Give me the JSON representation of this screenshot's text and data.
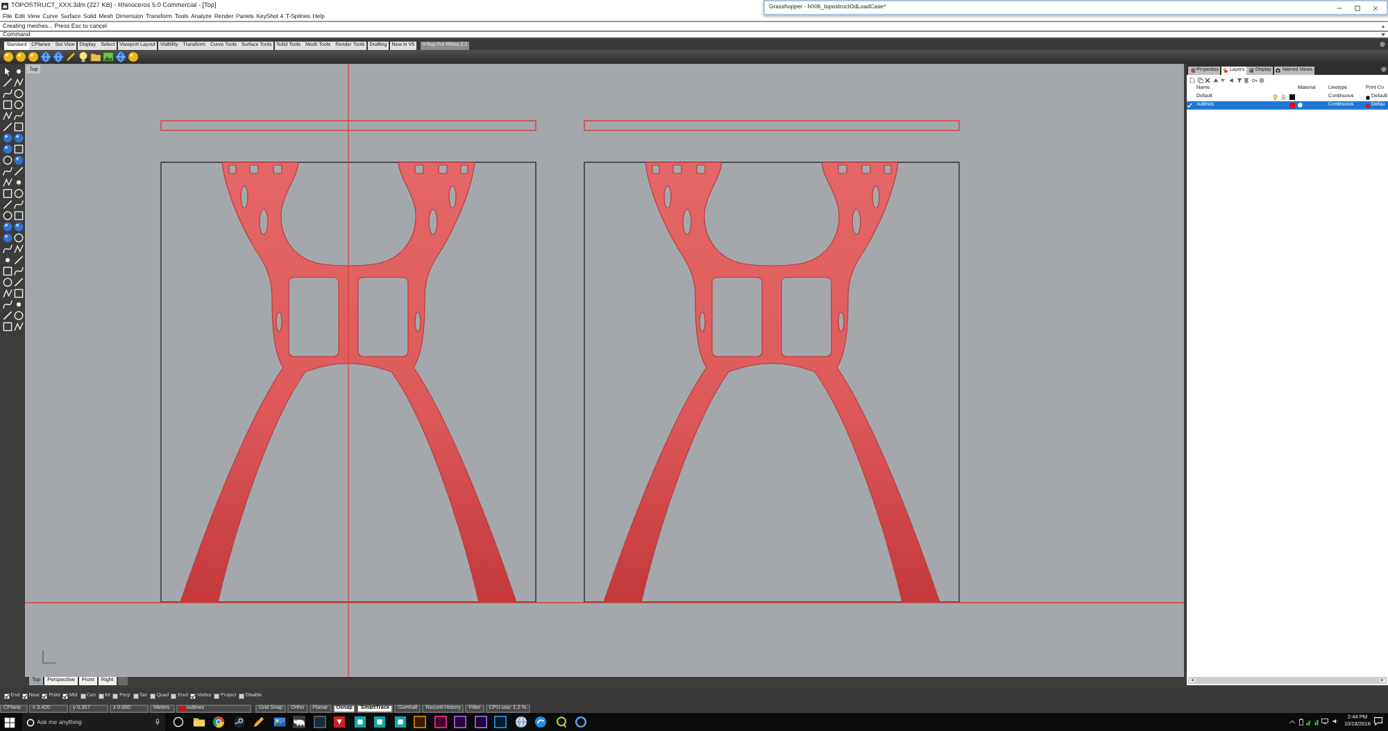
{
  "rhino_window": {
    "title": "TOPOSTRUCT_XXX.3dm (227 KB) - Rhinoceros 5.0 Commercial - [Top]",
    "menu": [
      "File",
      "Edit",
      "View",
      "Curve",
      "Surface",
      "Solid",
      "Mesh",
      "Dimension",
      "Transform",
      "Tools",
      "Analyze",
      "Render",
      "Panels",
      "KeyShot 4",
      "T-Splines",
      "Help"
    ],
    "command_history": "Creating meshes... Press Esc to cancel",
    "command_prompt": "Command",
    "toolbar_tabs": [
      {
        "label": "Standard",
        "selected": true
      },
      {
        "label": "CPlanes",
        "selected": false
      },
      {
        "label": "Set View",
        "selected": false
      },
      {
        "label": "Display",
        "selected": false
      },
      {
        "label": "Select",
        "selected": false
      },
      {
        "label": "Viewport Layout",
        "selected": false
      },
      {
        "label": "Visibility",
        "selected": false
      },
      {
        "label": "Transform",
        "selected": false
      },
      {
        "label": "Curve Tools",
        "selected": false
      },
      {
        "label": "Surface Tools",
        "selected": false
      },
      {
        "label": "Solid Tools",
        "selected": false
      },
      {
        "label": "Mesh Tools",
        "selected": false
      },
      {
        "label": "Render Tools",
        "selected": false
      },
      {
        "label": "Drafting",
        "selected": false
      },
      {
        "label": "New in V5",
        "selected": false
      }
    ],
    "toolbar_group_tab": "V-Ray For Rhino 2.1",
    "viewport": {
      "title": "Top"
    },
    "viewport_tabs": [
      {
        "label": "Top",
        "selected": true
      },
      {
        "label": "Perspective",
        "selected": false
      },
      {
        "label": "Front",
        "selected": false
      },
      {
        "label": "Right",
        "selected": false
      }
    ],
    "osnaps": [
      {
        "label": "End",
        "checked": true
      },
      {
        "label": "Near",
        "checked": true
      },
      {
        "label": "Point",
        "checked": true
      },
      {
        "label": "Mid",
        "checked": true
      },
      {
        "label": "Cen",
        "checked": false
      },
      {
        "label": "Int",
        "checked": false
      },
      {
        "label": "Perp",
        "checked": false
      },
      {
        "label": "Tan",
        "checked": false
      },
      {
        "label": "Quad",
        "checked": false
      },
      {
        "label": "Knot",
        "checked": false
      },
      {
        "label": "Vertex",
        "checked": true
      },
      {
        "label": "Project",
        "checked": false
      },
      {
        "label": "Disable",
        "checked": false
      }
    ],
    "status_bar": {
      "cplane": "CPlane",
      "coords": [
        "x 3.420",
        "y 0.357",
        "z 0.000"
      ],
      "units": "Meters",
      "layer": {
        "name": "outlines",
        "color": "#ff0000"
      },
      "toggles": [
        {
          "label": "Grid Snap",
          "on": false
        },
        {
          "label": "Ortho",
          "on": false
        },
        {
          "label": "Planar",
          "on": false
        },
        {
          "label": "Osnap",
          "on": true
        },
        {
          "label": "SmartTrack",
          "on": true
        },
        {
          "label": "Gumball",
          "on": false
        },
        {
          "label": "Record History",
          "on": false
        },
        {
          "label": "Filter",
          "on": false
        }
      ],
      "cpu": "CPU use: 1.2 %"
    }
  },
  "grasshopper_window": {
    "title": "Grasshopper - b006_topostructOdLoadCase*"
  },
  "layers_panel": {
    "tabs": [
      {
        "label": "Properties",
        "selected": false
      },
      {
        "label": "Layers",
        "selected": true
      },
      {
        "label": "Display",
        "selected": false
      },
      {
        "label": "Named Views",
        "selected": false
      }
    ],
    "columns": [
      "Name",
      "Material",
      "Linetype",
      "Print Co"
    ],
    "rows": [
      {
        "name": "Default",
        "selected": false,
        "current": false,
        "color": "#000000",
        "linetype": "Continuous",
        "print": {
          "color": "#000000",
          "width": "Default"
        }
      },
      {
        "name": "outlines",
        "selected": true,
        "current": true,
        "color": "#ff0000",
        "linetype": "Continuous",
        "print": {
          "color": "#ff0000",
          "width": "Defau"
        }
      }
    ]
  },
  "taskbar": {
    "search_placeholder": "Ask me anything",
    "time": "2:44 PM",
    "date": "10/18/2016"
  }
}
